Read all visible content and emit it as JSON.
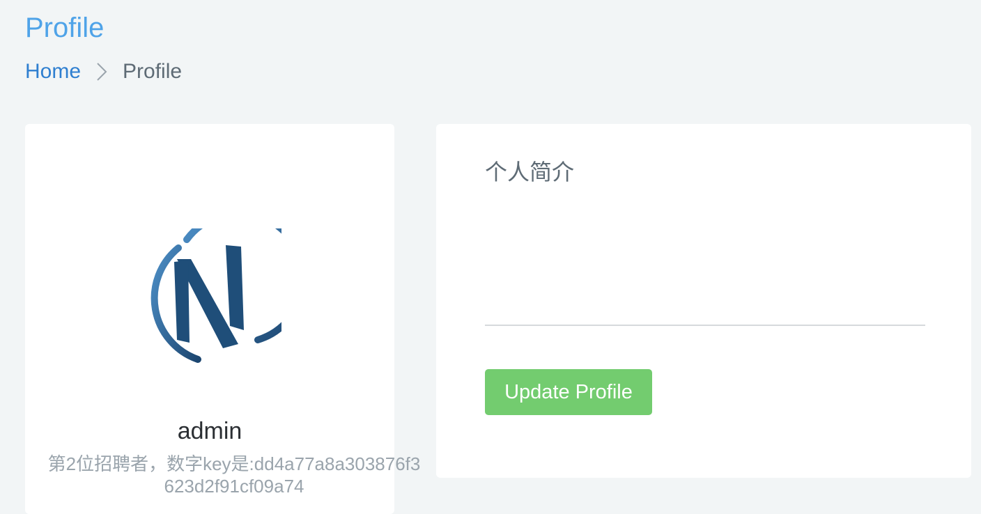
{
  "header": {
    "title": "Profile"
  },
  "breadcrumb": {
    "home_label": "Home",
    "separator_icon": "chevron-right-icon",
    "current_label": "Profile"
  },
  "profile_card": {
    "avatar_icon": "n-logo-icon",
    "username": "admin",
    "description": "第2位招聘者，数字key是:dd4a77a8a303876f3623d2f91cf09a74"
  },
  "bio_panel": {
    "section_title": "个人简介",
    "bio_value": "",
    "update_button_label": "Update Profile"
  },
  "colors": {
    "accent": "#4fa3e8",
    "link": "#2f7fd0",
    "button": "#73cc6f",
    "background": "#f2f5f6",
    "logo": "#1f4e79"
  }
}
